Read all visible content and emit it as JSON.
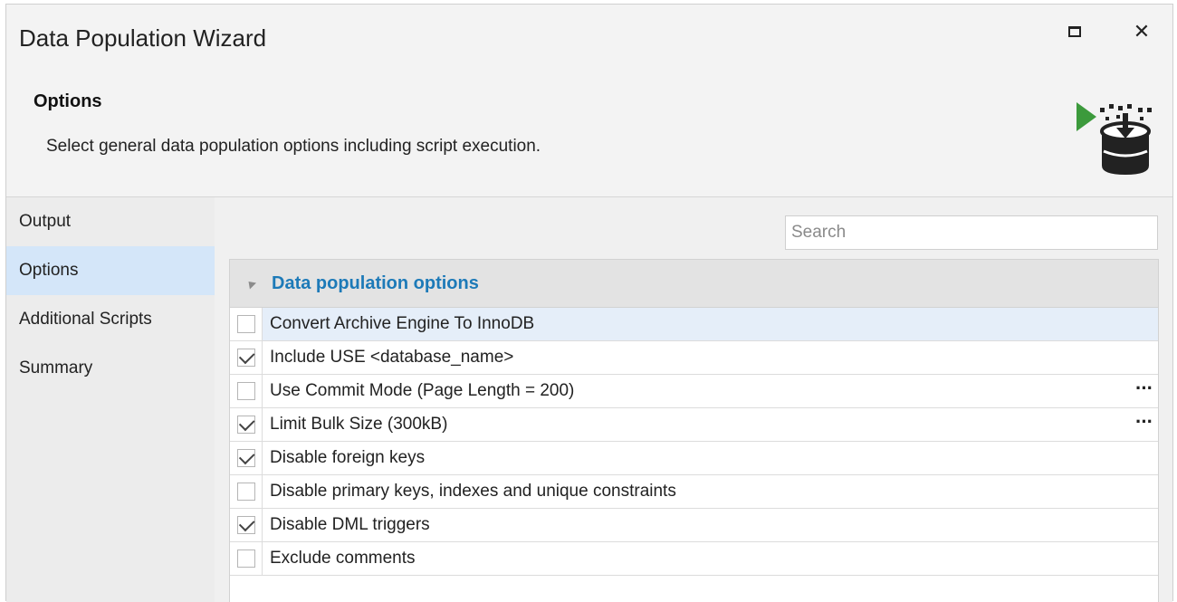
{
  "window": {
    "title": "Data Population Wizard",
    "maximize_icon": "maximize-icon",
    "close_icon": "close-icon",
    "close_glyph": "✕"
  },
  "header": {
    "step_title": "Options",
    "description": "Select general data population options including script execution.",
    "logo_icon": "data-population-icon",
    "logo_accent_color": "#3c9a3c"
  },
  "sidebar": {
    "items": [
      {
        "label": "Output",
        "selected": false
      },
      {
        "label": "Options",
        "selected": true
      },
      {
        "label": "Additional Scripts",
        "selected": false
      },
      {
        "label": "Summary",
        "selected": false
      }
    ]
  },
  "search": {
    "placeholder": "Search"
  },
  "options_group": {
    "title": "Data population options",
    "expanded": true,
    "title_color": "#1d7ab8",
    "rows": [
      {
        "label": "Convert Archive Engine To InnoDB",
        "checked": false,
        "has_ellipsis": false,
        "highlighted": true
      },
      {
        "label": "Include USE <database_name>",
        "checked": true,
        "has_ellipsis": false,
        "highlighted": false
      },
      {
        "label": "Use Commit Mode (Page Length = 200)",
        "checked": false,
        "has_ellipsis": true,
        "highlighted": false
      },
      {
        "label": "Limit Bulk Size (300kB)",
        "checked": true,
        "has_ellipsis": true,
        "highlighted": false
      },
      {
        "label": "Disable foreign keys",
        "checked": true,
        "has_ellipsis": false,
        "highlighted": false
      },
      {
        "label": "Disable primary keys, indexes and unique constraints",
        "checked": false,
        "has_ellipsis": false,
        "highlighted": false
      },
      {
        "label": "Disable DML triggers",
        "checked": true,
        "has_ellipsis": false,
        "highlighted": false
      },
      {
        "label": "Exclude comments",
        "checked": false,
        "has_ellipsis": false,
        "highlighted": false
      }
    ],
    "ellipsis_label": "···"
  }
}
